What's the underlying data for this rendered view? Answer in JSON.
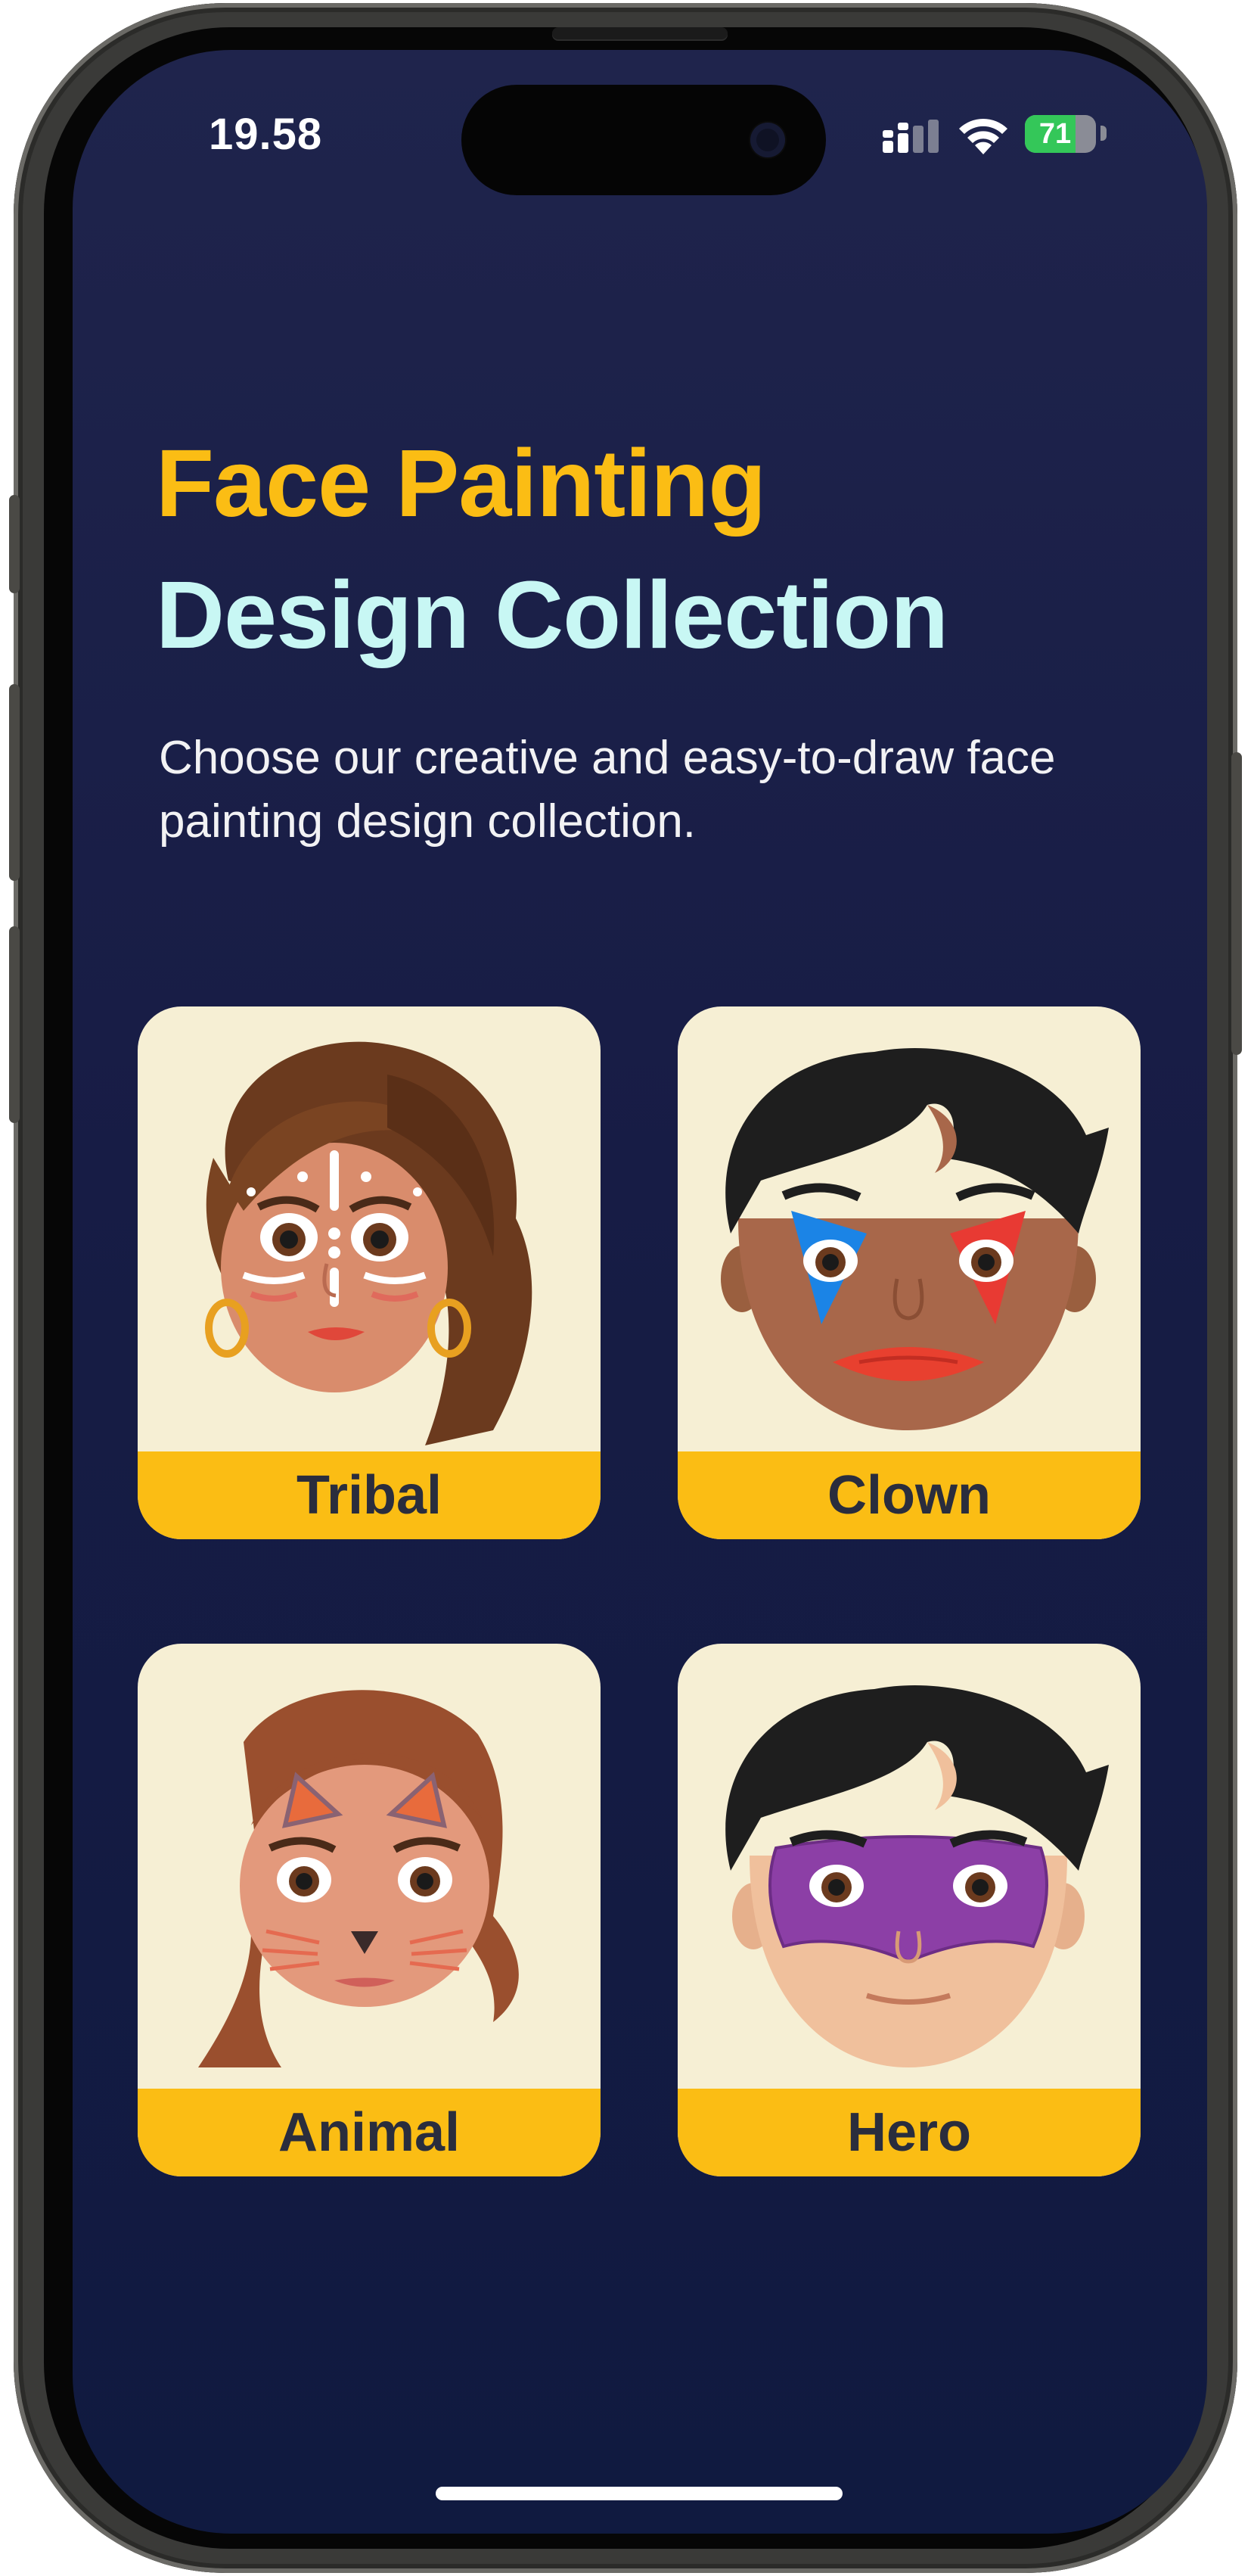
{
  "status_bar": {
    "time": "19.58",
    "battery_level": "71",
    "battery_fraction": 0.71
  },
  "header": {
    "title_line1": "Face Painting",
    "title_line2": "Design Collection",
    "subtitle": "Choose our creative and easy-to-draw face painting design collection."
  },
  "designs": [
    {
      "label": "Tribal",
      "icon": "tribal-face-icon"
    },
    {
      "label": "Clown",
      "icon": "clown-face-icon"
    },
    {
      "label": "Animal",
      "icon": "animal-face-icon"
    },
    {
      "label": "Hero",
      "icon": "hero-face-icon"
    }
  ],
  "colors": {
    "title_accent": "#fbbd14",
    "title_secondary": "#c8f7f4",
    "card_background": "#f6efd4",
    "card_label_bar": "#fbbd14",
    "screen_background": "#1a1f48"
  }
}
